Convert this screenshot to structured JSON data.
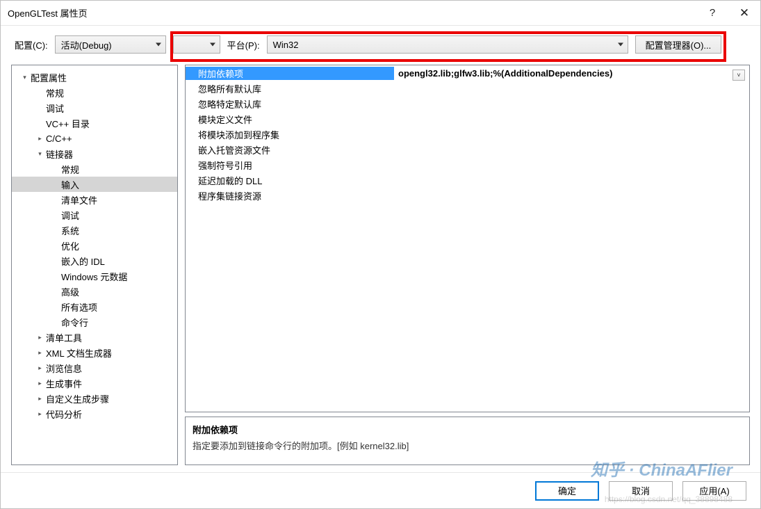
{
  "window": {
    "title": "OpenGLTest 属性页"
  },
  "titleButtons": {
    "help": "?",
    "close": "✕"
  },
  "toolbar": {
    "configLabel": "配置(C):",
    "configValue": "活动(Debug)",
    "platformLabel": "平台(P):",
    "platformValue": "Win32",
    "managerLabel": "配置管理器(O)..."
  },
  "tree": {
    "items": [
      {
        "label": "配置属性",
        "indent": 0,
        "exp": "▾"
      },
      {
        "label": "常规",
        "indent": 1,
        "exp": ""
      },
      {
        "label": "调试",
        "indent": 1,
        "exp": ""
      },
      {
        "label": "VC++ 目录",
        "indent": 1,
        "exp": ""
      },
      {
        "label": "C/C++",
        "indent": 1,
        "exp": "▸"
      },
      {
        "label": "链接器",
        "indent": 1,
        "exp": "▾"
      },
      {
        "label": "常规",
        "indent": 2,
        "exp": ""
      },
      {
        "label": "输入",
        "indent": 2,
        "exp": "",
        "selected": true
      },
      {
        "label": "清单文件",
        "indent": 2,
        "exp": ""
      },
      {
        "label": "调试",
        "indent": 2,
        "exp": ""
      },
      {
        "label": "系统",
        "indent": 2,
        "exp": ""
      },
      {
        "label": "优化",
        "indent": 2,
        "exp": ""
      },
      {
        "label": "嵌入的 IDL",
        "indent": 2,
        "exp": ""
      },
      {
        "label": "Windows 元数据",
        "indent": 2,
        "exp": ""
      },
      {
        "label": "高级",
        "indent": 2,
        "exp": ""
      },
      {
        "label": "所有选项",
        "indent": 2,
        "exp": ""
      },
      {
        "label": "命令行",
        "indent": 2,
        "exp": ""
      },
      {
        "label": "清单工具",
        "indent": 1,
        "exp": "▸"
      },
      {
        "label": "XML 文档生成器",
        "indent": 1,
        "exp": "▸"
      },
      {
        "label": "浏览信息",
        "indent": 1,
        "exp": "▸"
      },
      {
        "label": "生成事件",
        "indent": 1,
        "exp": "▸"
      },
      {
        "label": "自定义生成步骤",
        "indent": 1,
        "exp": "▸"
      },
      {
        "label": "代码分析",
        "indent": 1,
        "exp": "▸"
      }
    ]
  },
  "grid": {
    "rows": [
      {
        "name": "附加依赖项",
        "value": "opengl32.lib;glfw3.lib;%(AdditionalDependencies)",
        "selected": true
      },
      {
        "name": "忽略所有默认库",
        "value": ""
      },
      {
        "name": "忽略特定默认库",
        "value": ""
      },
      {
        "name": "模块定义文件",
        "value": ""
      },
      {
        "name": "将模块添加到程序集",
        "value": ""
      },
      {
        "name": "嵌入托管资源文件",
        "value": ""
      },
      {
        "name": "强制符号引用",
        "value": ""
      },
      {
        "name": "延迟加载的 DLL",
        "value": ""
      },
      {
        "name": "程序集链接资源",
        "value": ""
      }
    ]
  },
  "description": {
    "title": "附加依赖项",
    "text": "指定要添加到链接命令行的附加项。[例如 kernel32.lib]"
  },
  "footer": {
    "ok": "确定",
    "cancel": "取消",
    "apply": "应用(A)"
  },
  "watermarks": {
    "main": "知乎 · ChinaAFlier",
    "sub": "https://blog.csdn.net/qq_38898488"
  }
}
